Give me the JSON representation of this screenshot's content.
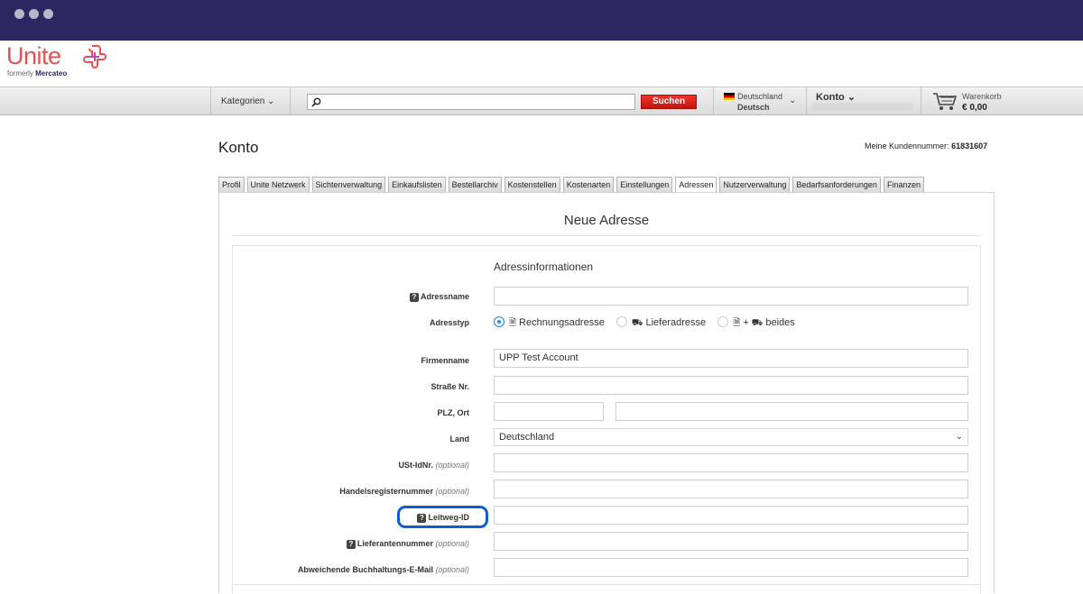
{
  "brand": {
    "name": "Unite",
    "formerly": "formerly",
    "formerly_brand": "Mercateo"
  },
  "nav": {
    "kategorien": "Kategorien",
    "search_placeholder": "",
    "search_button": "Suchen",
    "country": "Deutschland",
    "language": "Deutsch",
    "konto": "Konto",
    "cart_label": "Warenkorb",
    "cart_total": "€ 0,00"
  },
  "page": {
    "title": "Konto",
    "customer_number_label": "Meine Kundennummer:",
    "customer_number": "61831607"
  },
  "tabs": [
    {
      "label": "Profil"
    },
    {
      "label": "Unite Netzwerk"
    },
    {
      "label": "Sichtenverwaltung"
    },
    {
      "label": "Einkaufslisten"
    },
    {
      "label": "Bestellarchiv"
    },
    {
      "label": "Kostenstellen"
    },
    {
      "label": "Kostenarten"
    },
    {
      "label": "Einstellungen"
    },
    {
      "label": "Adressen",
      "active": true
    },
    {
      "label": "Nutzerverwaltung"
    },
    {
      "label": "Bedarfsanforderungen"
    },
    {
      "label": "Finanzen"
    }
  ],
  "form": {
    "panel_title": "Neue Adresse",
    "section_title": "Adressinformationen",
    "optional": "(optional)",
    "labels": {
      "adressname": "Adressname",
      "adresstyp": "Adresstyp",
      "firmenname": "Firmenname",
      "strasse": "Straße Nr.",
      "plz_ort": "PLZ, Ort",
      "land": "Land",
      "ustid": "USt-IdNr.",
      "handelsregister": "Handelsregisternummer",
      "leitweg": "Leitweg-ID",
      "lieferantennummer": "Lieferantennummer",
      "buchhaltung_mail": "Abweichende Buchhaltungs-E-Mail"
    },
    "address_types": [
      {
        "label": "Rechnungsadresse",
        "selected": true,
        "icon": "invoice-icon"
      },
      {
        "label": "Lieferadresse",
        "selected": false,
        "icon": "truck-icon"
      },
      {
        "label": "+",
        "label2": "beides",
        "selected": false,
        "icon": "invoice-truck-icon"
      }
    ],
    "values": {
      "adressname": "",
      "firmenname": "UPP Test Account",
      "strasse": "",
      "plz": "",
      "ort": "",
      "land": "Deutschland",
      "ustid": "",
      "handelsregister": "",
      "leitweg": "",
      "lieferantennummer": "",
      "buchhaltung_mail": ""
    }
  },
  "colors": {
    "header": "#2c2760",
    "brand": "#e8504f",
    "button": "#d8201a",
    "radio": "#2a8cdb",
    "highlight": "#0a5fd9"
  }
}
